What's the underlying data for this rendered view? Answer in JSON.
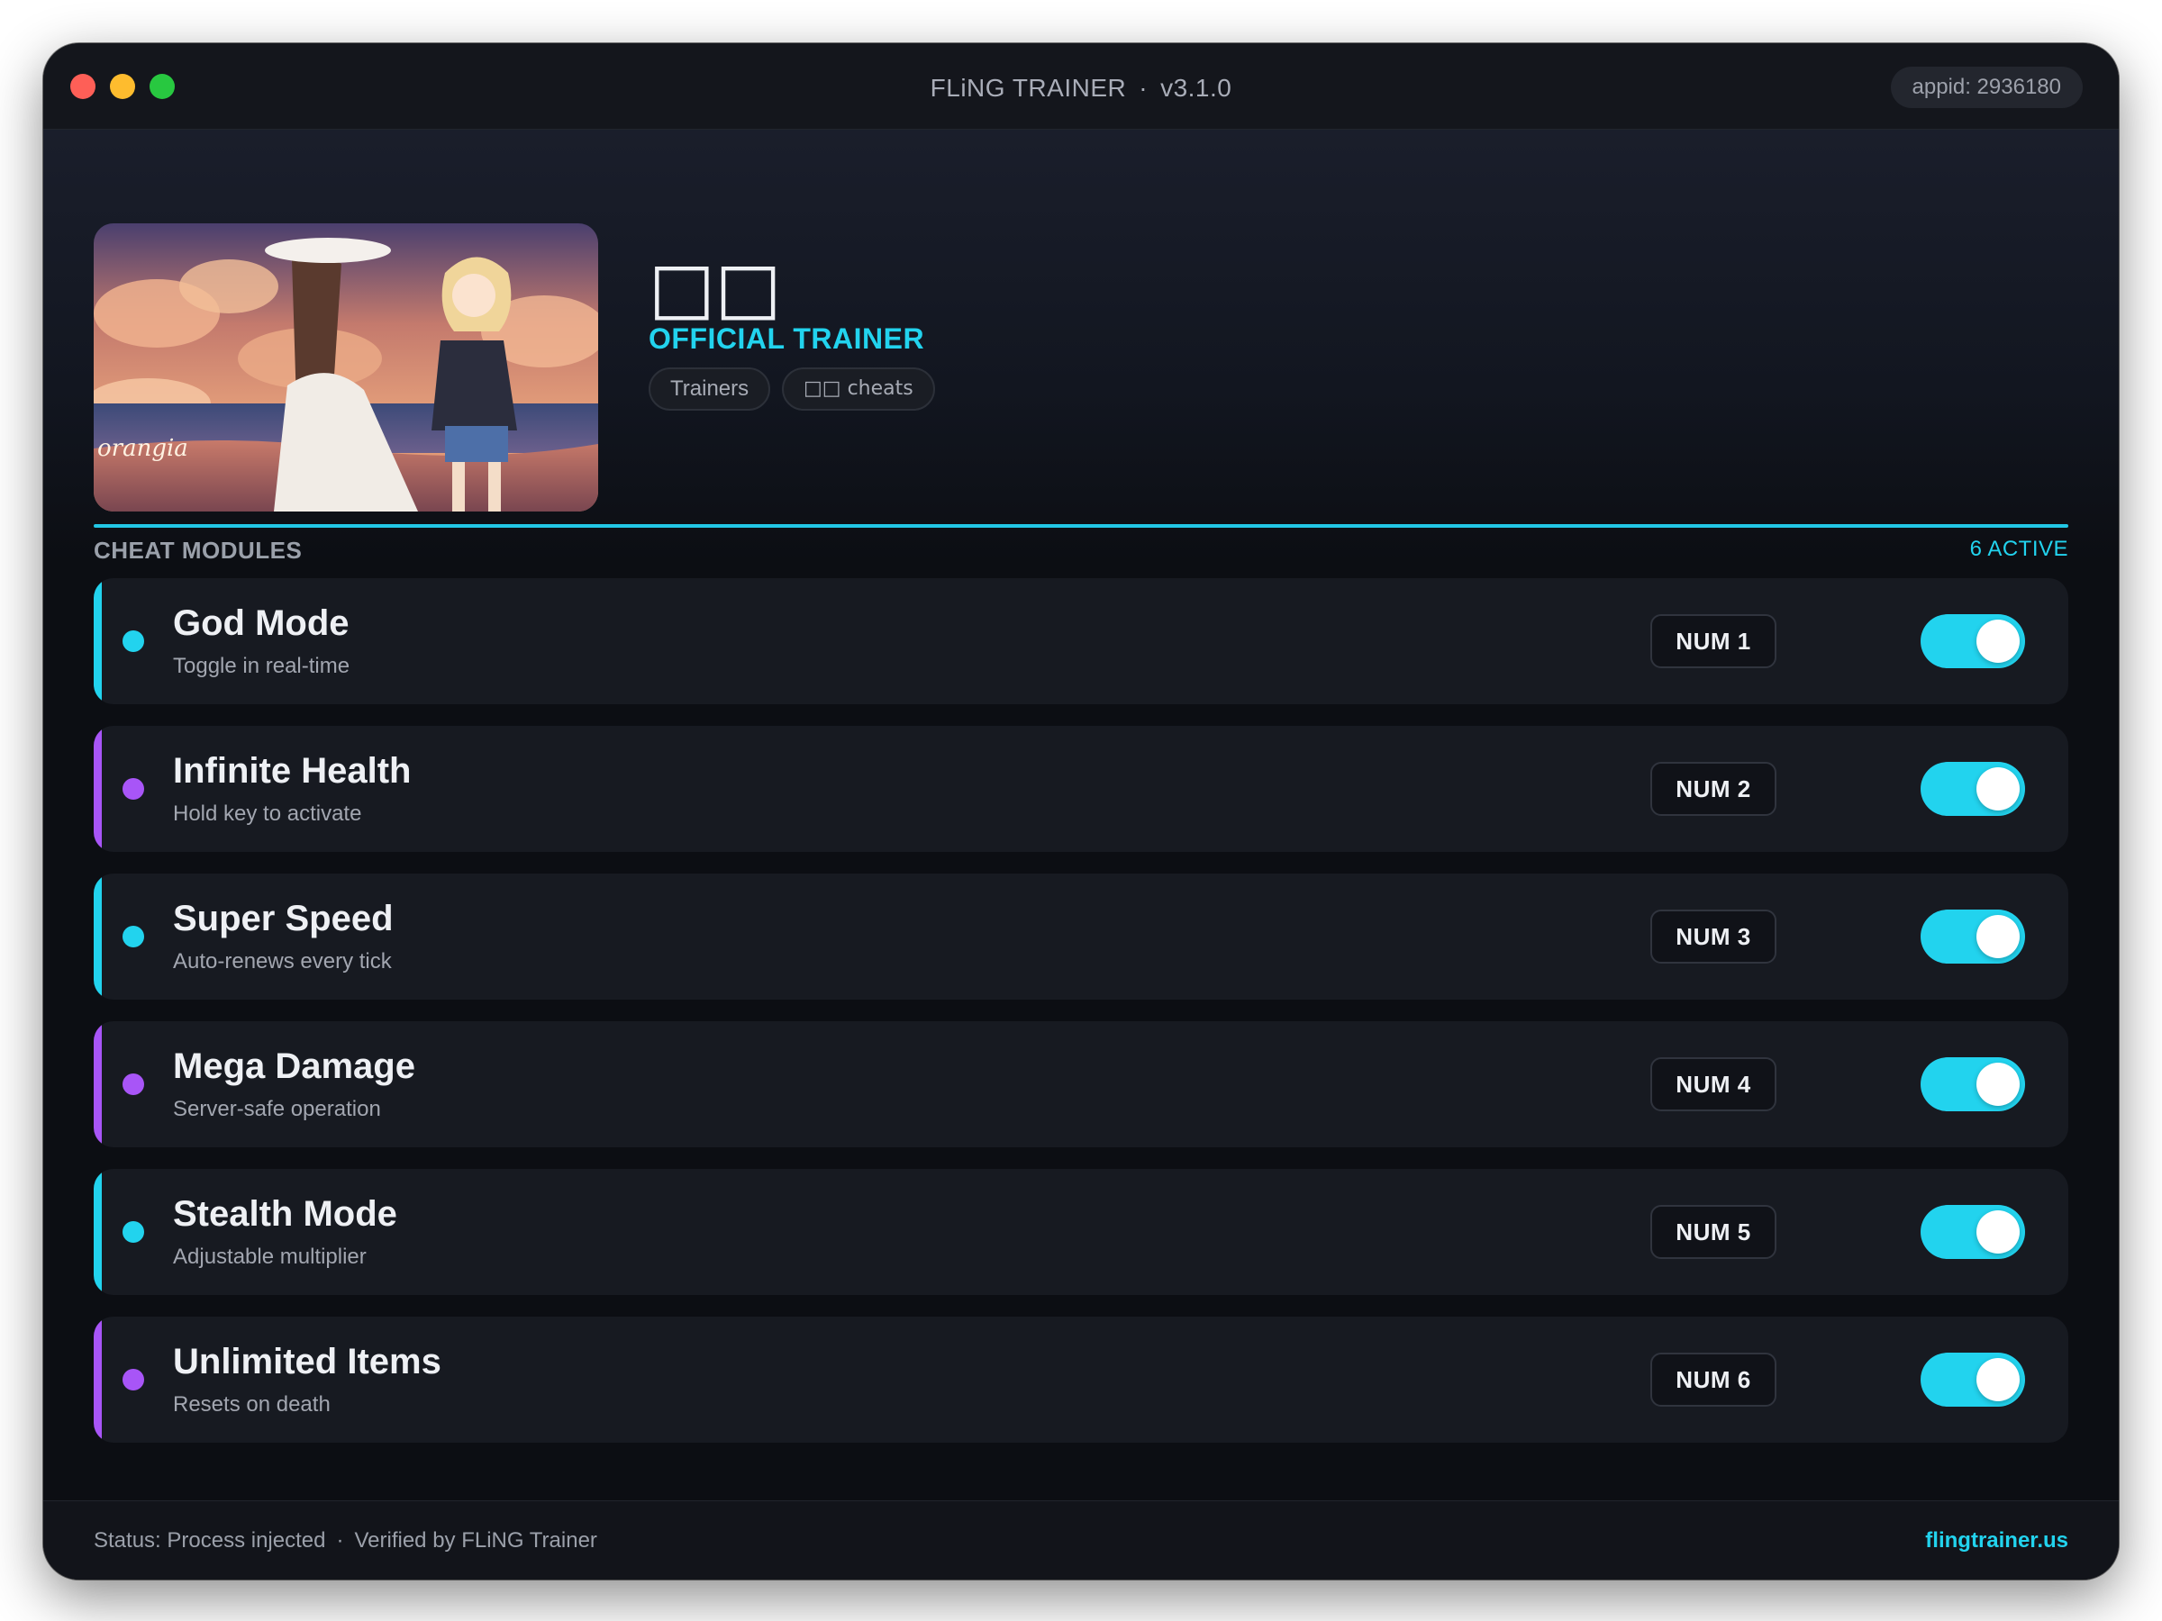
{
  "window": {
    "title": "FLiNG TRAINER",
    "separator": "·",
    "version": "v3.1.0",
    "appid": "appid: 2936180"
  },
  "game": {
    "title": "□□",
    "subtitle": "OFFICIAL TRAINER",
    "cover_logo": "orangia",
    "tags": [
      "Trainers",
      "□□ cheats"
    ]
  },
  "section": {
    "title": "CHEAT MODULES",
    "active_count": "6 ACTIVE"
  },
  "cheats": [
    {
      "name": "God Mode",
      "desc": "Toggle in real-time",
      "key": "NUM 1",
      "accent": "#22d3ee",
      "enabled": true
    },
    {
      "name": "Infinite Health",
      "desc": "Hold key to activate",
      "key": "NUM 2",
      "accent": "#a855f7",
      "enabled": true
    },
    {
      "name": "Super Speed",
      "desc": "Auto-renews every tick",
      "key": "NUM 3",
      "accent": "#22d3ee",
      "enabled": true
    },
    {
      "name": "Mega Damage",
      "desc": "Server-safe operation",
      "key": "NUM 4",
      "accent": "#a855f7",
      "enabled": true
    },
    {
      "name": "Stealth Mode",
      "desc": "Adjustable multiplier",
      "key": "NUM 5",
      "accent": "#22d3ee",
      "enabled": true
    },
    {
      "name": "Unlimited Items",
      "desc": "Resets on death",
      "key": "NUM 6",
      "accent": "#a855f7",
      "enabled": true
    }
  ],
  "footer": {
    "status": "Status: Process injected",
    "separator": "·",
    "verified": "Verified by FLiNG Trainer",
    "site": "flingtrainer.us"
  },
  "colors": {
    "accent_cyan": "#22d3ee",
    "accent_purple": "#a855f7",
    "background": "#0c0e13",
    "card": "#171a21"
  }
}
